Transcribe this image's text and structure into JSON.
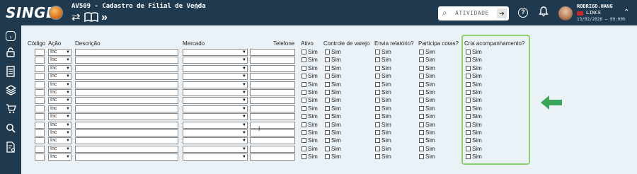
{
  "app": {
    "logo": "SINGE",
    "screen_title": "AV509 - Cadastro de Filial de Venda"
  },
  "search": {
    "placeholder": "ATIVIDADE"
  },
  "user": {
    "name": "RODRIGO.HANG",
    "company": "LINCE",
    "datetime": "13/02/2026 — 09:00h"
  },
  "table": {
    "headers": {
      "codigo": "Código",
      "acao": "Ação",
      "descricao": "Descrição",
      "mercado": "Mercado",
      "telefone": "Telefone",
      "ativo": "Ativo",
      "controle_varejo": "Controle de varejo",
      "envia_relatorio": "Envia relatório?",
      "participa_cotas": "Participa cotas?",
      "cria_acompanhamento": "Cria acompanhamento?"
    },
    "acao_value": "Inc",
    "checkbox_label": "Sim",
    "row_count": 14
  },
  "colors": {
    "topbar": "#1f3a4f",
    "content_bg": "#eaf2f8",
    "highlight": "#8dd36a",
    "arrow": "#3aa55a"
  }
}
